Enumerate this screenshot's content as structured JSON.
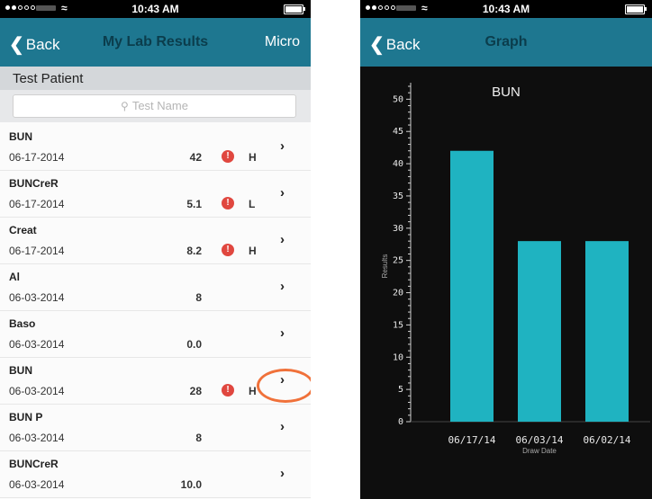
{
  "status_bar": {
    "time": "10:43 AM"
  },
  "left": {
    "nav": {
      "back": "Back",
      "title": "My Lab Results",
      "right": "Micro"
    },
    "patient": "Test Patient",
    "search": {
      "placeholder": "Test Name"
    },
    "rows": [
      {
        "name": "BUN",
        "date": "06-17-2014",
        "value": "42",
        "alert": true,
        "flag": "H"
      },
      {
        "name": "BUNCreR",
        "date": "06-17-2014",
        "value": "5.1",
        "alert": true,
        "flag": "L"
      },
      {
        "name": "Creat",
        "date": "06-17-2014",
        "value": "8.2",
        "alert": true,
        "flag": "H"
      },
      {
        "name": "Al",
        "date": "06-03-2014",
        "value": "8",
        "alert": false,
        "flag": ""
      },
      {
        "name": "Baso",
        "date": "06-03-2014",
        "value": "0.0",
        "alert": false,
        "flag": ""
      },
      {
        "name": "BUN",
        "date": "06-03-2014",
        "value": "28",
        "alert": true,
        "flag": "H"
      },
      {
        "name": "BUN P",
        "date": "06-03-2014",
        "value": "8",
        "alert": false,
        "flag": ""
      },
      {
        "name": "BUNCreR",
        "date": "06-03-2014",
        "value": "10.0",
        "alert": false,
        "flag": ""
      }
    ],
    "alert_glyph": "!"
  },
  "right": {
    "nav": {
      "back": "Back",
      "title": "Graph"
    }
  },
  "colors": {
    "nav_bg": "#1e7790",
    "bar": "#1fb3c1",
    "alert": "#e0473f",
    "callout": "#f0713a"
  },
  "chart_data": {
    "type": "bar",
    "title": "BUN",
    "categories": [
      "06/17/14",
      "06/03/14",
      "06/02/14"
    ],
    "values": [
      42,
      28,
      28
    ],
    "xlabel": "Draw Date",
    "ylabel": "Results",
    "ylim": [
      0,
      52
    ],
    "yticks": [
      0,
      5,
      10,
      15,
      20,
      25,
      30,
      35,
      40,
      45,
      50
    ],
    "grid": false
  }
}
